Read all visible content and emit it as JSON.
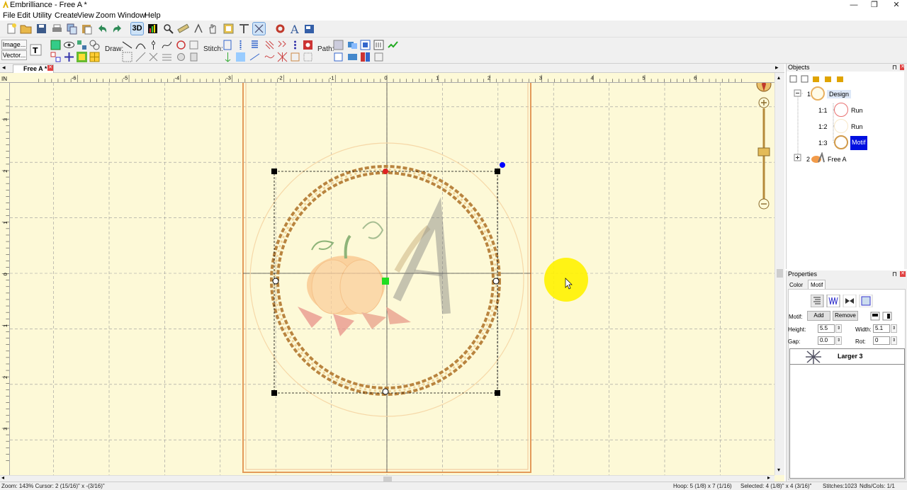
{
  "window": {
    "title": "Embrilliance - Free A *",
    "minimize": "—",
    "restore": "❐",
    "close": "✕"
  },
  "menu": [
    "File",
    "Edit",
    "Utility",
    "Create",
    "View",
    "Zoom",
    "Window",
    "Help"
  ],
  "toolbar": {
    "image_label": "Image...",
    "vector_label": "Vector...",
    "draw_label": "Draw:",
    "stitch_label": "Stitch:",
    "path_label": "Path:",
    "three_d_label": "3D"
  },
  "document": {
    "tab_label": "Free A *"
  },
  "ruler": {
    "h_ticks": [
      "-6",
      "-5",
      "-4",
      "-3",
      "-2",
      "-1",
      "0",
      "1",
      "2",
      "3",
      "4",
      "5",
      "6"
    ],
    "v_ticks": [
      "3",
      "2",
      "1",
      "0",
      "1",
      "2",
      "3"
    ],
    "corner": "IN"
  },
  "compass": {
    "label": "N"
  },
  "objects_panel": {
    "title": "Objects",
    "items": [
      {
        "number": "1",
        "label": "Design"
      },
      {
        "number": "1:1",
        "label": "Run"
      },
      {
        "number": "1:2",
        "label": "Run"
      },
      {
        "number": "1:3",
        "label": "Motif"
      },
      {
        "number": "2",
        "label": "Free A"
      }
    ]
  },
  "properties_panel": {
    "title": "Properties",
    "tabs": [
      "Color",
      "Motif"
    ],
    "motif_label": "Motif:",
    "add_label": "Add",
    "remove_label": "Remove",
    "height_label": "Height:",
    "height_value": "5.5",
    "width_label": "Width:",
    "width_value": "5.1",
    "gap_label": "Gap:",
    "gap_value": "0.0",
    "rot_label": "Rot:",
    "rot_value": "0",
    "motif_name": "Larger 3"
  },
  "status": {
    "zoom_cursor": "Zoom: 143%  Cursor: 2 (15/16)\" x -(3/16)\"",
    "hoop": "Hoop: 5 (1/8) x 7 (1/16)",
    "selected": "Selected: 4 (1/8)\" x 4 (3/16)\"",
    "stitches": "Stitches:1023",
    "ndls": "Ndls/Cols: 1/1"
  },
  "colors": {
    "canvas": "#fdf9d7",
    "hoop": "#e39a5a",
    "motif_ring": "#b9843f",
    "selection_blue": "#0000ff",
    "cursor_highlight": "#fff200"
  }
}
